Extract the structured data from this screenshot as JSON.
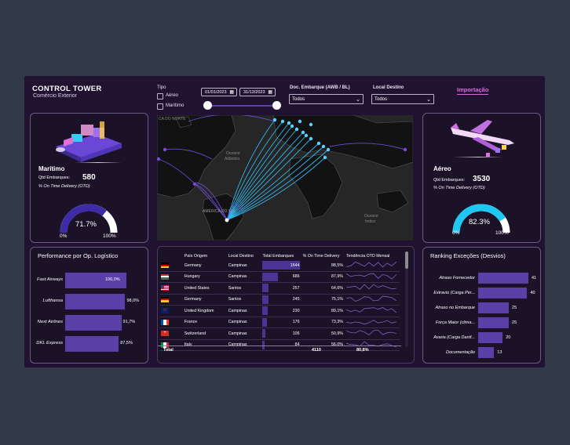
{
  "header": {
    "title": "CONTROL TOWER",
    "subtitle": "Comércio Exterior"
  },
  "filters": {
    "tipo_label": "Tipo",
    "tipo_options": [
      {
        "label": "Aéreo",
        "checked": false
      },
      {
        "label": "Marítimo",
        "checked": false
      }
    ],
    "date_start": "01/01/2023",
    "date_end": "31/12/2023",
    "doc_label": "Doc. Embarque (AWB / BL)",
    "doc_value": "Todos",
    "local_label": "Local Destino",
    "local_value": "Todos",
    "importacao_label": "Importação"
  },
  "maritimo": {
    "title": "Marítimo",
    "qtd_label": "Qtd Embarques:",
    "qtd_value": "580",
    "otd_label": "% On Time Delivery (OTD)",
    "gauge_value": "71.7%",
    "gauge_pct": 0.717,
    "gauge_min": "0%",
    "gauge_max": "100%"
  },
  "aereo": {
    "title": "Aéreo",
    "qtd_label": "Qtd Embarques:",
    "qtd_value": "3530",
    "otd_label": "% On Time Delivery (OTD)",
    "gauge_value": "82.3%",
    "gauge_pct": 0.823,
    "gauge_min": "0%",
    "gauge_max": "100%"
  },
  "map": {
    "label_north": "CA DO NORTE",
    "label_atlantic_1": "Oceano",
    "label_atlantic_2": "Atlântico",
    "label_south": "AMÉRICA DO SUL",
    "label_indian_1": "Oceano",
    "label_indian_2": "Índico"
  },
  "performance": {
    "title": "Performance por Op. Logístico",
    "items": [
      {
        "name": "Fast Airways",
        "value": "100,0%",
        "pct": 1.0
      },
      {
        "name": "Lufthansa",
        "value": "98,0%",
        "pct": 0.98
      },
      {
        "name": "Next Airlines",
        "value": "91,7%",
        "pct": 0.917
      },
      {
        "name": "DKL Express",
        "value": "87,5%",
        "pct": 0.875
      }
    ]
  },
  "table": {
    "headers": [
      "País Origem",
      "Local Destino",
      "Total Embarques",
      "% On Time Delivery",
      "Tendência OTD Mensal"
    ],
    "rows": [
      {
        "flag": "germany",
        "pais": "Germany",
        "local": "Campinas",
        "total": "1644",
        "otd": "88,5%",
        "total_num": 1644
      },
      {
        "flag": "hungary",
        "pais": "Hungary",
        "local": "Campinas",
        "total": "686",
        "otd": "87,9%",
        "total_num": 686
      },
      {
        "flag": "usa",
        "pais": "United States",
        "local": "Santos",
        "total": "257",
        "otd": "64,6%",
        "total_num": 257
      },
      {
        "flag": "germany",
        "pais": "Germany",
        "local": "Santos",
        "total": "245",
        "otd": "75,1%",
        "total_num": 245
      },
      {
        "flag": "uk",
        "pais": "United Kingdom",
        "local": "Campinas",
        "total": "230",
        "otd": "89,1%",
        "total_num": 230
      },
      {
        "flag": "france",
        "pais": "France",
        "local": "Campinas",
        "total": "176",
        "otd": "73,3%",
        "total_num": 176
      },
      {
        "flag": "switzerland",
        "pais": "Switzerland",
        "local": "Campinas",
        "total": "106",
        "otd": "50,9%",
        "total_num": 106
      },
      {
        "flag": "italy",
        "pais": "Italy",
        "local": "Campinas",
        "total": "84",
        "otd": "56,0%",
        "total_num": 84
      }
    ],
    "total_label": "Total",
    "total_embarques": "4110",
    "total_otd": "80,8%"
  },
  "ranking": {
    "title": "Ranking Exceções (Desvios)",
    "items": [
      {
        "name": "Atraso Fornecedor",
        "value": "41",
        "num": 41
      },
      {
        "name": "Extravio (Carga Per...",
        "value": "40",
        "num": 40
      },
      {
        "name": "Atraso no Embarque",
        "value": "25",
        "num": 25
      },
      {
        "name": "Força Maior (clima...",
        "value": "25",
        "num": 25
      },
      {
        "name": "Avaria (Carga Danif...",
        "value": "20",
        "num": 20
      },
      {
        "name": "Documentação",
        "value": "13",
        "num": 13
      }
    ]
  },
  "colors": {
    "accent": "#5a3fa8",
    "gauge_maritimo": "#3d2ba8",
    "gauge_aereo": "#1fc8f2",
    "importacao": "#d76ad8"
  }
}
